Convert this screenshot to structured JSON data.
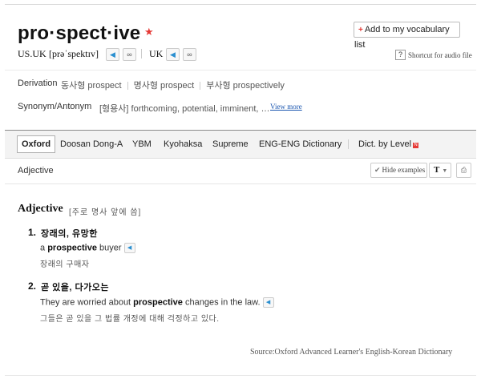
{
  "entry": {
    "headword": "pro·spect·ive",
    "star": "★",
    "add_vocab": "Add to my vocabulary list",
    "add_vocab_icon": "+",
    "pron_us_label": "US.UK",
    "pron_us_ipa": "[prəˈspektɪv]",
    "pron_uk_label": "UK",
    "audio_icon": "speaker-icon",
    "repeat_icon": "repeat-icon",
    "help_glyph": "?",
    "shortcut": "Shortcut for audio file"
  },
  "derivation": {
    "label": "Derivation",
    "items": [
      "동사형 prospect",
      "명사형 prospect",
      "부사형 prospectively"
    ]
  },
  "synonym": {
    "label": "Synonym/Antonym",
    "text": "[형용사] forthcoming, potential, imminent, …",
    "view_more": "View more"
  },
  "tabs": {
    "active": "Oxford",
    "items": [
      "Doosan Dong-A",
      "YBM",
      "Kyohaksa",
      "Supreme",
      "ENG-ENG Dictionary"
    ],
    "level": "Dict. by Level",
    "new_badge": "N"
  },
  "subheader": {
    "pos": "Adjective",
    "hide_examples": "Hide examples",
    "check_glyph": "✔",
    "font_button": "T",
    "caret_glyph": "▼",
    "print_glyph": "⎙"
  },
  "definition": {
    "pos": "Adjective",
    "pos_note": "[주로 명사 앞에 씀]",
    "senses": [
      {
        "num": "1.",
        "meaning": "장래의, 유망한",
        "example_pre": "a ",
        "example_bold": "prospective",
        "example_post": " buyer",
        "translation": "장래의 구매자"
      },
      {
        "num": "2.",
        "meaning": "곧 있을, 다가오는",
        "example_pre": "They are worried about ",
        "example_bold": "prospective",
        "example_post": " changes in the law.",
        "translation": "그들은 곧 있을 그 법률 개정에 대해 걱정하고 있다."
      }
    ],
    "speaker_glyph": "◀"
  },
  "source": "Source:Oxford Advanced Learner's English-Korean Dictionary",
  "colors": {
    "accent_red": "#e53935",
    "link_blue": "#1a56b0",
    "audio_blue": "#2a8fd0"
  }
}
